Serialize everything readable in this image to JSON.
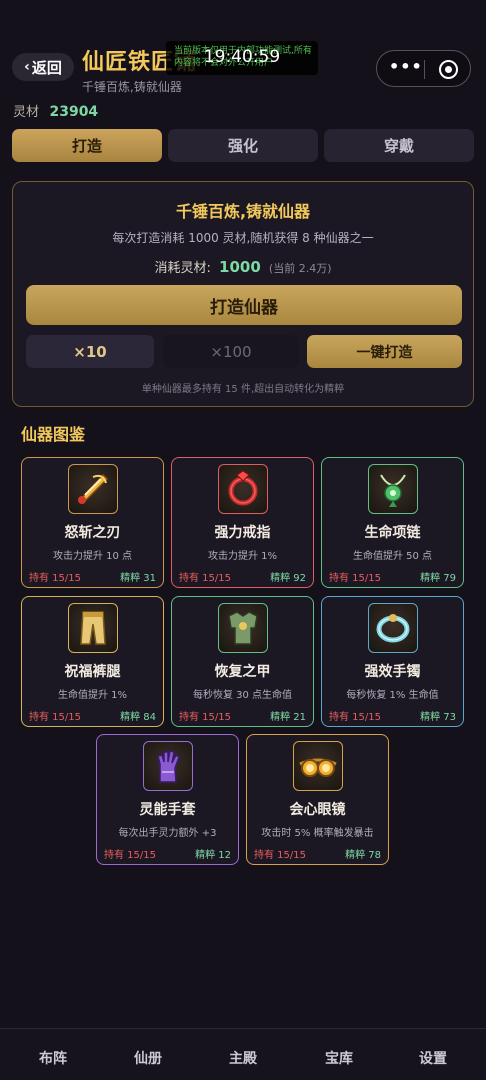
{
  "header": {
    "back_label": "返回",
    "title": "仙匠铁匠铺",
    "subtitle": "千锤百炼,铸就仙器",
    "notice_text": "当前版本仅用于内部功能测试,所有内容将不会对外公开用户",
    "clock": "19:40:59"
  },
  "currency": {
    "label": "灵材",
    "value": "23904"
  },
  "tabs": [
    {
      "label": "打造",
      "active": true
    },
    {
      "label": "强化",
      "active": false
    },
    {
      "label": "穿戴",
      "active": false
    }
  ],
  "forge": {
    "title": "千锤百炼,铸就仙器",
    "description": "每次打造消耗 1000 灵材,随机获得 8 种仙器之一",
    "cost_label": "消耗灵材:",
    "cost_value": "1000",
    "cost_current": "(当前 2.4万)",
    "main_button": "打造仙器",
    "x10_button": "×10",
    "x100_button": "×100",
    "auto_button": "一键打造",
    "note": "单种仙器最多持有 15 件,超出自动转化为精粹"
  },
  "catalog": {
    "title": "仙器图鉴",
    "items": [
      {
        "name": "怒斩之刃",
        "effect": "攻击力提升 10 点",
        "held": "持有 15/15",
        "essence": "精粹 31",
        "icon": "blade-icon",
        "border": "#c9974f"
      },
      {
        "name": "强力戒指",
        "effect": "攻击力提升 1%",
        "held": "持有 15/15",
        "essence": "精粹 92",
        "icon": "ring-icon",
        "border": "#d9605e"
      },
      {
        "name": "生命项链",
        "effect": "生命值提升 50 点",
        "held": "持有 15/15",
        "essence": "精粹 79",
        "icon": "necklace-icon",
        "border": "#5fbf85"
      },
      {
        "name": "祝福裤腿",
        "effect": "生命值提升 1%",
        "held": "持有 15/15",
        "essence": "精粹 84",
        "icon": "leggings-icon",
        "border": "#d4b25a"
      },
      {
        "name": "恢复之甲",
        "effect": "每秒恢复 30 点生命值",
        "held": "持有 15/15",
        "essence": "精粹 21",
        "icon": "armor-icon",
        "border": "#5fbf85"
      },
      {
        "name": "强效手镯",
        "effect": "每秒恢复 1% 生命值",
        "held": "持有 15/15",
        "essence": "精粹 73",
        "icon": "bracelet-icon",
        "border": "#5aa8c9"
      },
      {
        "name": "灵能手套",
        "effect": "每次出手灵力额外 +3",
        "held": "持有 15/15",
        "essence": "精粹 12",
        "icon": "glove-icon",
        "border": "#9a6cd0"
      },
      {
        "name": "会心眼镜",
        "effect": "攻击时 5% 概率触发暴击",
        "held": "持有 15/15",
        "essence": "精粹 78",
        "icon": "goggles-icon",
        "border": "#d4a24a"
      }
    ]
  },
  "nav": [
    {
      "label": "布阵"
    },
    {
      "label": "仙册"
    },
    {
      "label": "主殿"
    },
    {
      "label": "宝库"
    },
    {
      "label": "设置"
    }
  ],
  "colors": {
    "accent_gold": "#f2c95a",
    "value_green": "#7ed8a3",
    "held_red": "#e85d5d"
  }
}
